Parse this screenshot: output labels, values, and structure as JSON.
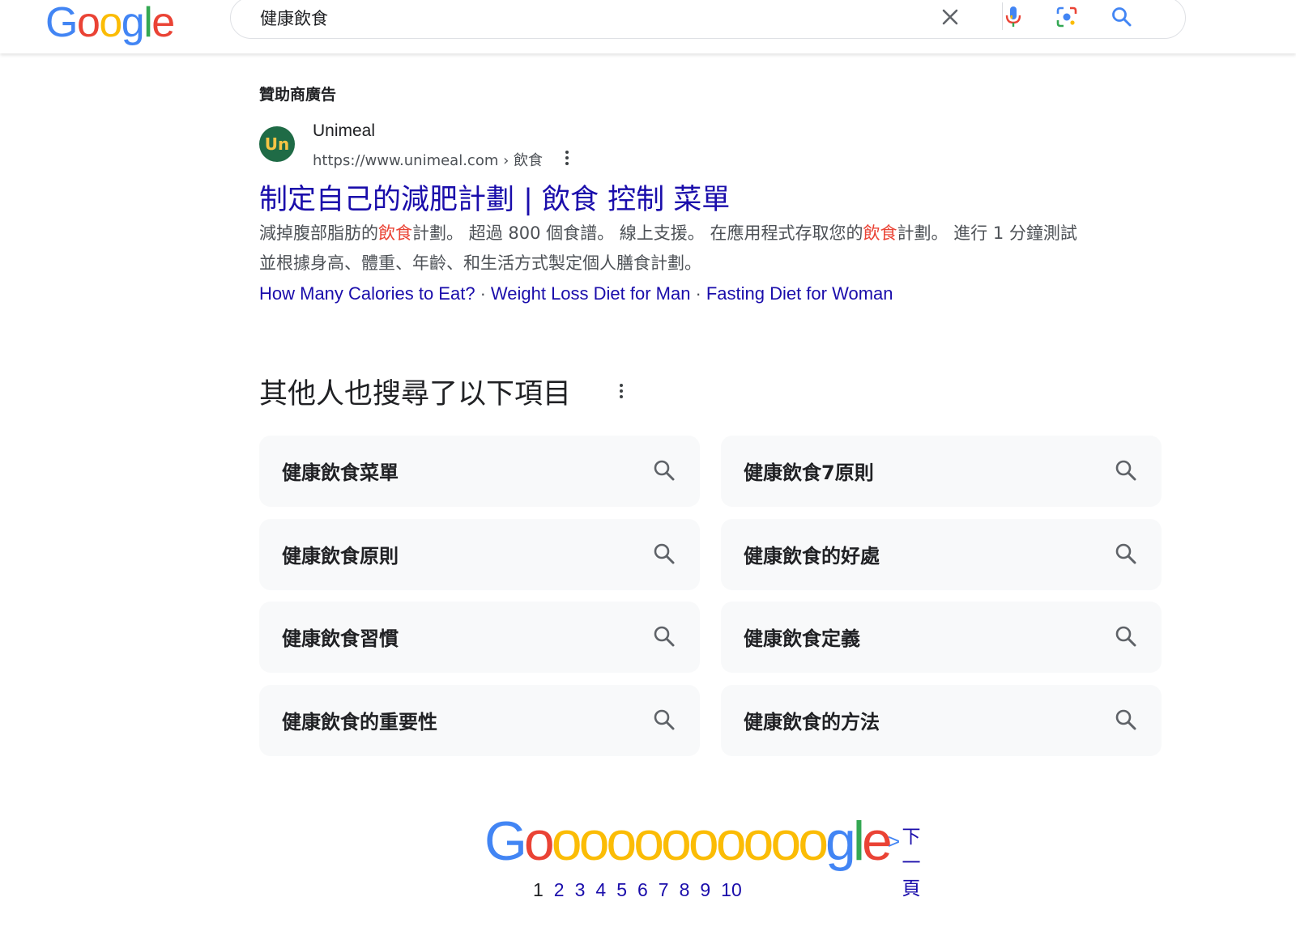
{
  "header": {
    "logo_letters": [
      "G",
      "o",
      "o",
      "g",
      "l",
      "e"
    ],
    "search_query": "健康飲食"
  },
  "ad": {
    "label": "贊助商廣告",
    "favicon_text": "Un",
    "site_name": "Unimeal",
    "url": "https://www.unimeal.com › 飲食",
    "title": "制定自己的減肥計劃 | 飲食 控制 菜單",
    "desc_parts": [
      "減掉腹部脂肪的",
      "飲食",
      "計劃。 超過 800 個食譜。 線上支援。 在應用程式存取您的",
      "飲食",
      "計劃。 進行 1 分鐘測試並根據身高、體重、年齡、和生活方式製定個人膳食計劃。"
    ],
    "sitelinks": [
      "How Many Calories to Eat?",
      "Weight Loss Diet for Man",
      "Fasting Diet for Woman"
    ],
    "sitelink_separator": "·"
  },
  "people_also_search": {
    "title": "其他人也搜尋了以下項目",
    "items": [
      "健康飲食菜單",
      "健康飲食7原則",
      "健康飲食原則",
      "健康飲食的好處",
      "健康飲食習慣",
      "健康飲食定義",
      "健康飲食的重要性",
      "健康飲食的方法"
    ]
  },
  "pagination": {
    "logo": [
      "G",
      "o",
      "o",
      "o",
      "o",
      "o",
      "o",
      "o",
      "o",
      "o",
      "o",
      "o",
      "g",
      "l",
      "e"
    ],
    "pages": [
      "1",
      "2",
      "3",
      "4",
      "5",
      "6",
      "7",
      "8",
      "9",
      "10"
    ],
    "current_page": "1",
    "next_arrow": ">",
    "next_label": "下一頁"
  },
  "colors": {
    "link": "#1a0dab",
    "highlight": "#ea4335",
    "chip_bg": "#f8f9fa"
  }
}
